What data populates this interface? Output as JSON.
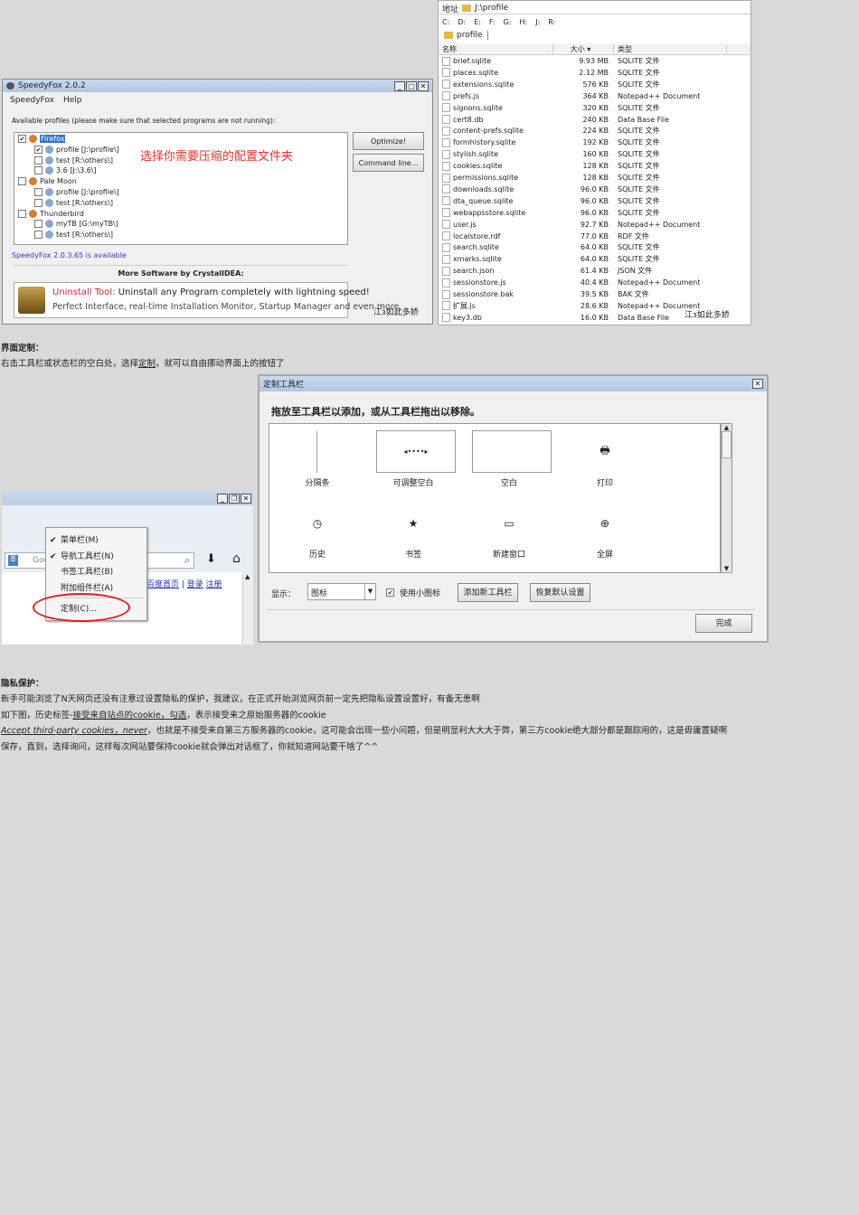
{
  "speedyfox": {
    "title": "SpeedyFox 2.0.2",
    "menu": [
      "SpeedyFox",
      "Help"
    ],
    "instructions": "Available profiles (please make sure that selected programs are not running):",
    "tree": [
      {
        "label": "Firefox",
        "level": 0,
        "checked": true,
        "selected": true
      },
      {
        "label": "profile [J:\\profile\\]",
        "level": 1,
        "checked": true
      },
      {
        "label": "test [R:\\others\\]",
        "level": 1,
        "checked": false
      },
      {
        "label": "3.6 [J:\\3.6\\]",
        "level": 1,
        "checked": false
      },
      {
        "label": "Pale Moon",
        "level": 0,
        "checked": false
      },
      {
        "label": "profile [J:\\profile\\]",
        "level": 1,
        "checked": false
      },
      {
        "label": "test [R:\\others\\]",
        "level": 1,
        "checked": false
      },
      {
        "label": "Thunderbird",
        "level": 0,
        "checked": false
      },
      {
        "label": "myTB [G:\\myTB\\]",
        "level": 1,
        "checked": false
      },
      {
        "label": "test [R:\\others\\]",
        "level": 1,
        "checked": false
      }
    ],
    "annotation": "选择你需要压缩的配置文件夹",
    "optimize": "Optimize!",
    "command_line": "Command line...",
    "update": "SpeedyFox 2.0.3.65 is available",
    "more_software": "More Software by CrystalIDEA:",
    "ad_title": "Uninstall Tool:",
    "ad_line1": " Uninstall any Program completely with lightning speed!",
    "ad_line2": "Perfect Interface, real-time Installation Monitor, Startup Manager and even more.",
    "watermark": "江з如此多娇"
  },
  "explorer": {
    "address_label": "地址",
    "address": "J:\\profile",
    "drives": [
      "C:",
      "D:",
      "E:",
      "F:",
      "G:",
      "H:",
      "J:",
      "R:"
    ],
    "tab": "profile",
    "columns": [
      "名称",
      "大小 ▾",
      "类型"
    ],
    "files": [
      [
        "brief.sqlite",
        "9.93 MB",
        "SQLITE 文件"
      ],
      [
        "places.sqlite",
        "2.12 MB",
        "SQLITE 文件"
      ],
      [
        "extensions.sqlite",
        "576 KB",
        "SQLITE 文件"
      ],
      [
        "prefs.js",
        "364 KB",
        "Notepad++ Document"
      ],
      [
        "signons.sqlite",
        "320 KB",
        "SQLITE 文件"
      ],
      [
        "cert8.db",
        "240 KB",
        "Data Base File"
      ],
      [
        "content-prefs.sqlite",
        "224 KB",
        "SQLITE 文件"
      ],
      [
        "formhistory.sqlite",
        "192 KB",
        "SQLITE 文件"
      ],
      [
        "stylish.sqlite",
        "160 KB",
        "SQLITE 文件"
      ],
      [
        "cookies.sqlite",
        "128 KB",
        "SQLITE 文件"
      ],
      [
        "permissions.sqlite",
        "128 KB",
        "SQLITE 文件"
      ],
      [
        "downloads.sqlite",
        "96.0 KB",
        "SQLITE 文件"
      ],
      [
        "dta_queue.sqlite",
        "96.0 KB",
        "SQLITE 文件"
      ],
      [
        "webappsstore.sqlite",
        "96.0 KB",
        "SQLITE 文件"
      ],
      [
        "user.js",
        "92.7 KB",
        "Notepad++ Document"
      ],
      [
        "localstore.rdf",
        "77.0 KB",
        "RDF 文件"
      ],
      [
        "search.sqlite",
        "64.0 KB",
        "SQLITE 文件"
      ],
      [
        "xmarks.sqlite",
        "64.0 KB",
        "SQLITE 文件"
      ],
      [
        "search.json",
        "61.4 KB",
        "JSON 文件"
      ],
      [
        "sessionstore.js",
        "40.4 KB",
        "Notepad++ Document"
      ],
      [
        "sessionstore.bak",
        "39.5 KB",
        "BAK 文件"
      ],
      [
        "扩展.js",
        "28.6 KB",
        "Notepad++ Document"
      ],
      [
        "key3.db",
        "16.0 KB",
        "Data Base File"
      ]
    ],
    "watermark": "江з如此多娇"
  },
  "section1": {
    "heading": "界面定制：",
    "text_pre": "右击工具栏或状态栏的空白处，选择",
    "text_link": "定制",
    "text_post": "，就可以自由挪动界面上的按钮了"
  },
  "context_menu": {
    "items": [
      {
        "label": "菜单栏(M)",
        "checked": true
      },
      {
        "label": "导航工具栏(N)",
        "checked": true
      },
      {
        "label": "书签工具栏(B)",
        "checked": false
      },
      {
        "label": "附加组件栏(A)",
        "checked": false
      },
      {
        "label": "定制(C)...",
        "checked": false
      }
    ],
    "search_placeholder": "Goo",
    "links": [
      "百度首页",
      "登录",
      "注册"
    ]
  },
  "customize": {
    "title": "定制工具栏",
    "instruction": "拖放至工具栏以添加，或从工具栏拖出以移除。",
    "items": [
      "分隔条",
      "可调整空白",
      "空白",
      "打印",
      "历史",
      "书签",
      "新建窗口",
      "全屏"
    ],
    "show_label": "显示：",
    "show_value": "图标",
    "small_icons": "使用小图标",
    "small_icons_checked": true,
    "add_toolbar": "添加新工具栏",
    "restore": "恢复默认设置",
    "done": "完成"
  },
  "section2": {
    "heading": "隐私保护：",
    "line1": "新手可能浏览了N天网页还没有注意过设置隐私的保护，我建议，在正式开始浏览网页前一定先把隐私设置设置好，有备无患啊",
    "line2_pre": "如下图，历史标签-",
    "line2_link": "接受来自站点的cookie，勾选",
    "line2_post": "，表示接受来之原始服务器的cookie",
    "line3_link": "Accept third-party cookies，never",
    "line3_post": "，也就是不接受来自第三方服务器的cookie，这可能会出现一些小问题，但是明显利大大大于弊，第三方cookie绝大部分都是跟踪用的，这是毋庸置疑啊",
    "line4": "保存，直到，选择询问，这样每次网站要保持cookie就会弹出对话框了，你就知道网站要干啥了^^"
  }
}
